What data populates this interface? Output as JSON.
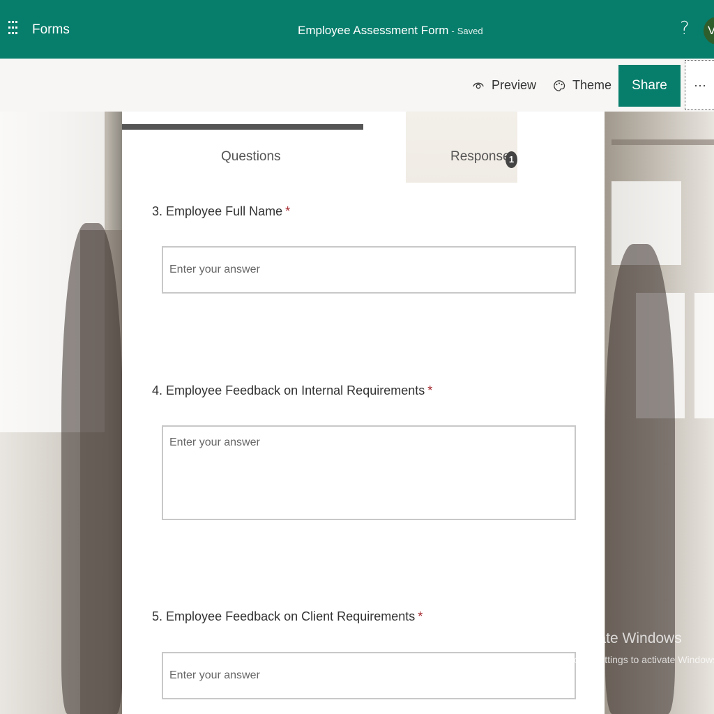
{
  "header": {
    "app_name": "Forms",
    "title": "Employee Assessment Form",
    "separator": "-",
    "status": "Saved",
    "help_label": "?",
    "avatar_initials": "VI",
    "brand_color": "#077d6b"
  },
  "commands": {
    "preview_label": "Preview",
    "theme_label": "Theme",
    "share_label": "Share",
    "more_label": "···"
  },
  "tabs": {
    "questions_label": "Questions",
    "responses_label": "Responses",
    "responses_count": "1"
  },
  "questions": [
    {
      "number": "3.",
      "text": "Employee Full Name",
      "required_mark": "*",
      "placeholder": "Enter your answer"
    },
    {
      "number": "4.",
      "text": "Employee Feedback on Internal Requirements",
      "required_mark": "*",
      "placeholder": "Enter your answer"
    },
    {
      "number": "5.",
      "text": "Employee Feedback on Client Requirements",
      "required_mark": "*",
      "placeholder": "Enter your answer"
    }
  ],
  "watermark": {
    "title": "Activate Windows",
    "subtitle": "Go to Settings to activate Windows."
  }
}
